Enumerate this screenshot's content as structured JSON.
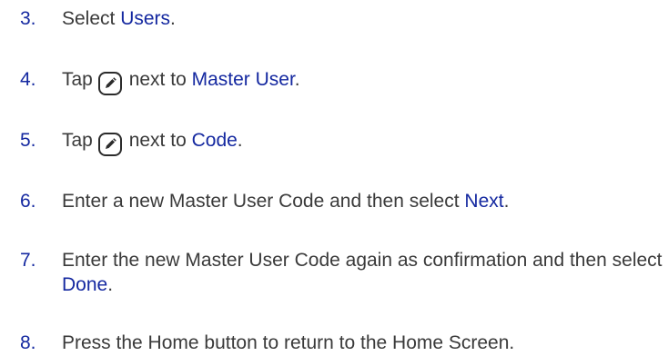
{
  "colors": {
    "accent": "#1428a0",
    "body_text": "#3a3a3a",
    "icon_stroke": "#2b2b2b"
  },
  "icons": {
    "edit": "pencil-edit-icon"
  },
  "steps": [
    {
      "number": "3.",
      "text_before": "Select ",
      "keyword": "Users",
      "text_after": "."
    },
    {
      "number": "4.",
      "text_before": "Tap",
      "text_middle": "next to ",
      "keyword": "Master User",
      "text_after": "."
    },
    {
      "number": "5.",
      "text_before": "Tap",
      "text_middle": "next to ",
      "keyword": "Code",
      "text_after": "."
    },
    {
      "number": "6.",
      "text_before": "Enter a new Master User Code and then select ",
      "keyword": "Next",
      "text_after": "."
    },
    {
      "number": "7.",
      "text_before": "Enter the new Master User Code again as confirmation and then select ",
      "keyword": "Done",
      "text_after": "."
    },
    {
      "number": "8.",
      "text_before": "Press the Home button to return to the Home Screen."
    }
  ]
}
